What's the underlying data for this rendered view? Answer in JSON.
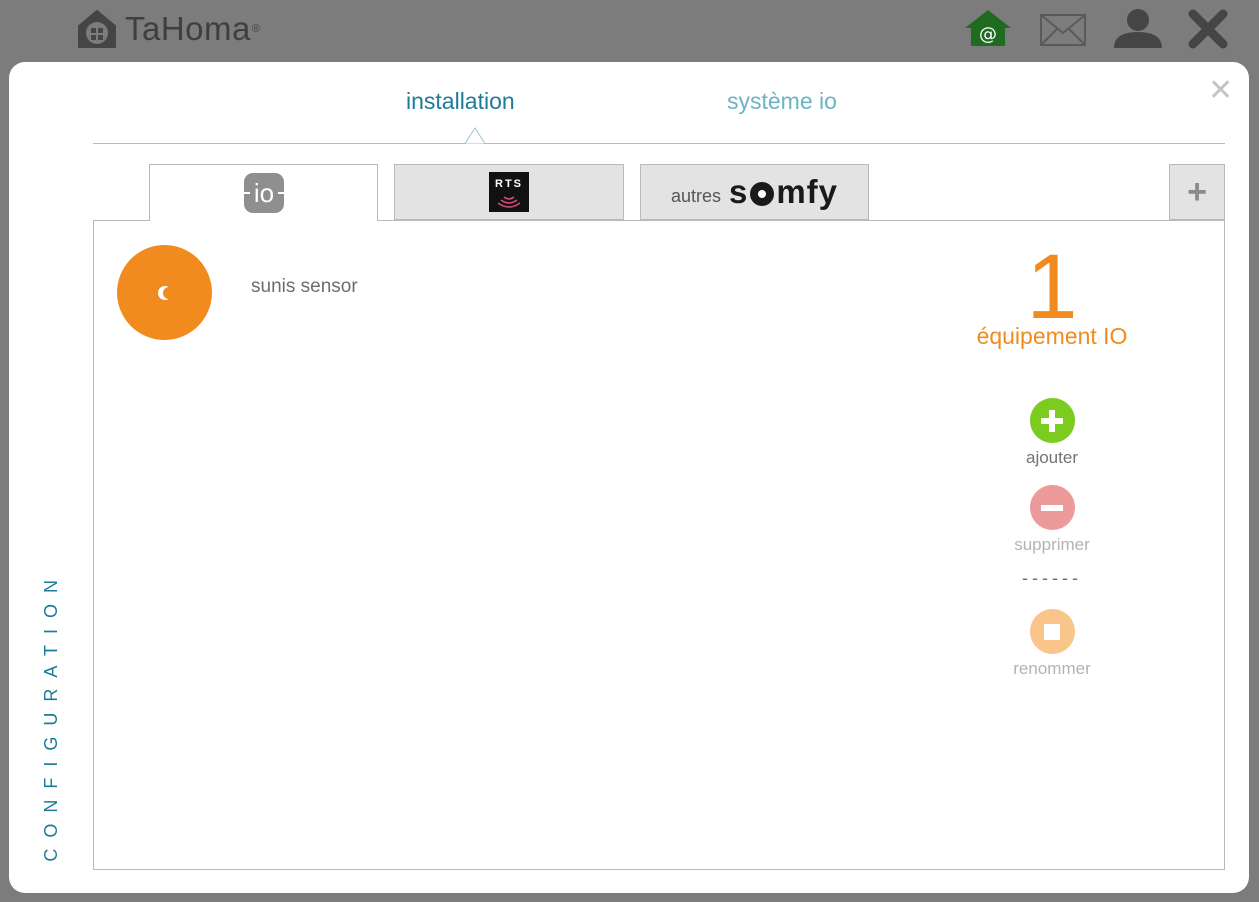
{
  "header": {
    "brand": "TaHoma",
    "brand_mark": "®",
    "icons": [
      "home-at-icon",
      "mail-icon",
      "user-icon",
      "close-icon"
    ]
  },
  "modal": {
    "side_label": "CONFIGURATION",
    "nav_tabs": [
      {
        "label": "installation",
        "active": true
      },
      {
        "label": "système io",
        "active": false
      }
    ],
    "protocol_tabs": [
      {
        "id": "io",
        "label": "io",
        "active": true
      },
      {
        "id": "rts",
        "label": "RTS",
        "active": false
      },
      {
        "id": "somfy",
        "prefix": "autres",
        "label": "somfy",
        "active": false
      }
    ],
    "add_tab_label": "+",
    "devices": [
      {
        "name": "sunis sensor",
        "icon": "moon-sensor-icon"
      }
    ],
    "summary": {
      "count": "1",
      "label": "équipement IO"
    },
    "actions": {
      "add": "ajouter",
      "remove": "supprimer",
      "separator": "------",
      "rename": "renommer"
    }
  },
  "colors": {
    "accent_orange": "#f28b1f",
    "accent_teal": "#1c7c98",
    "add_green": "#7ccb1f",
    "remove_pink": "#ec9a9a",
    "rename_peach": "#f9c58b",
    "home_green": "#2a6f2a"
  }
}
